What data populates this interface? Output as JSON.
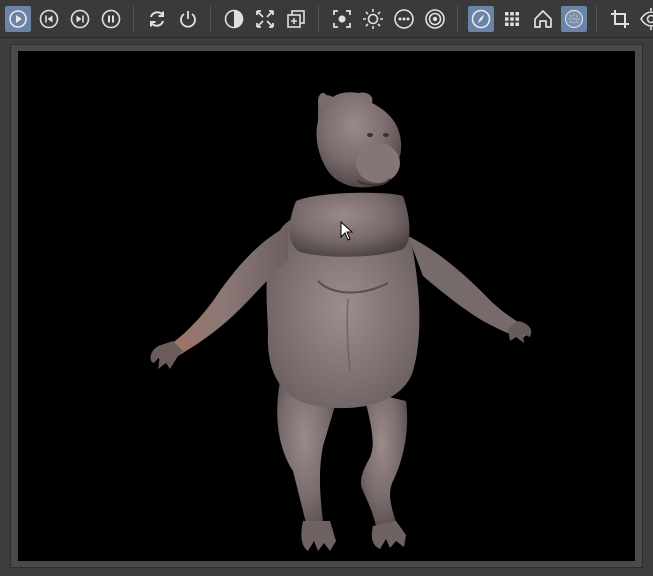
{
  "toolbar": {
    "groups": [
      [
        {
          "icon": "play-icon",
          "active": true
        },
        {
          "icon": "skip-back-icon",
          "active": false
        },
        {
          "icon": "skip-forward-icon",
          "active": false
        },
        {
          "icon": "pause-icon",
          "active": false
        }
      ],
      [
        {
          "icon": "refresh-icon",
          "active": false
        },
        {
          "icon": "power-icon",
          "active": false
        }
      ],
      [
        {
          "icon": "contrast-icon",
          "active": false
        },
        {
          "icon": "expand-icon",
          "active": false
        },
        {
          "icon": "add-frame-icon",
          "active": false
        }
      ],
      [
        {
          "icon": "focus-icon",
          "active": false
        },
        {
          "icon": "brightness-icon",
          "active": false
        },
        {
          "icon": "more-icon",
          "active": false
        },
        {
          "icon": "target-icon",
          "active": false
        }
      ],
      [
        {
          "icon": "compass-icon",
          "active": true
        },
        {
          "icon": "grid-icon",
          "active": false
        },
        {
          "icon": "home-icon",
          "active": false
        },
        {
          "icon": "texture-icon",
          "active": true
        }
      ],
      [
        {
          "icon": "crop-icon",
          "active": false
        },
        {
          "icon": "eye-icon",
          "active": false
        }
      ]
    ]
  },
  "viewport": {
    "background": "#000000",
    "model": "hippo-creature-3d-model",
    "skin_color": "#8a7a78"
  },
  "colors": {
    "active_button": "#6b83a6",
    "icon": "#e0e0e0",
    "toolbar_bg": "#3a3a3a"
  }
}
